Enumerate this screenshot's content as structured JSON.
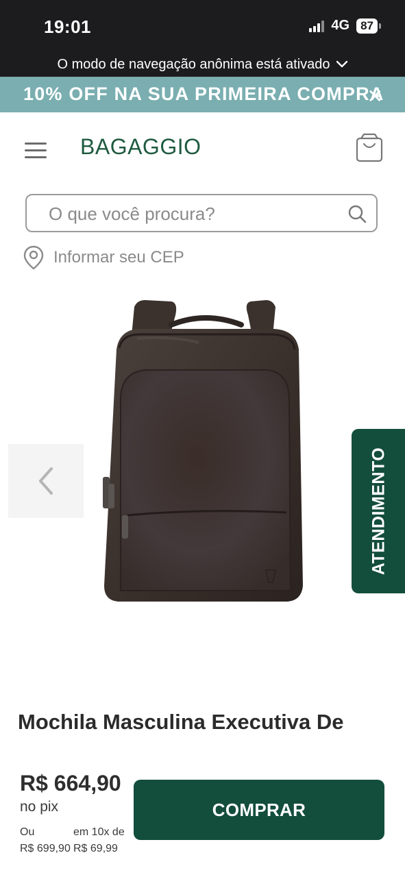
{
  "status_bar": {
    "time": "19:01",
    "network": "4G",
    "battery": "87"
  },
  "incognito_bar": {
    "text": "O modo de navegação anônima está ativado"
  },
  "promo_banner": {
    "text": "10% OFF NA SUA PRIMEIRA COMPRA",
    "close_icon": "close-icon"
  },
  "header": {
    "logo": "BAGAGGIO",
    "menu_icon": "hamburger-menu-icon",
    "cart_icon": "shopping-bag-icon"
  },
  "search": {
    "placeholder": "O que você procura?",
    "value": ""
  },
  "cep": {
    "label": "Informar seu CEP",
    "icon": "location-pin-icon"
  },
  "side_tab": {
    "label": "ATENDIMENTO"
  },
  "product": {
    "title": "Mochila Masculina Executiva De",
    "price": "R$ 664,90",
    "price_method": "no pix",
    "alt_label": "Ou",
    "alt_price": "R$ 699,90",
    "installments_label": "em 10x de",
    "installment_value": "R$ 69,99"
  },
  "actions": {
    "buy_label": "COMPRAR"
  },
  "colors": {
    "brand_green": "#134d3c",
    "promo_teal": "#7aaeb0",
    "status_bg": "#1c1c1e"
  }
}
